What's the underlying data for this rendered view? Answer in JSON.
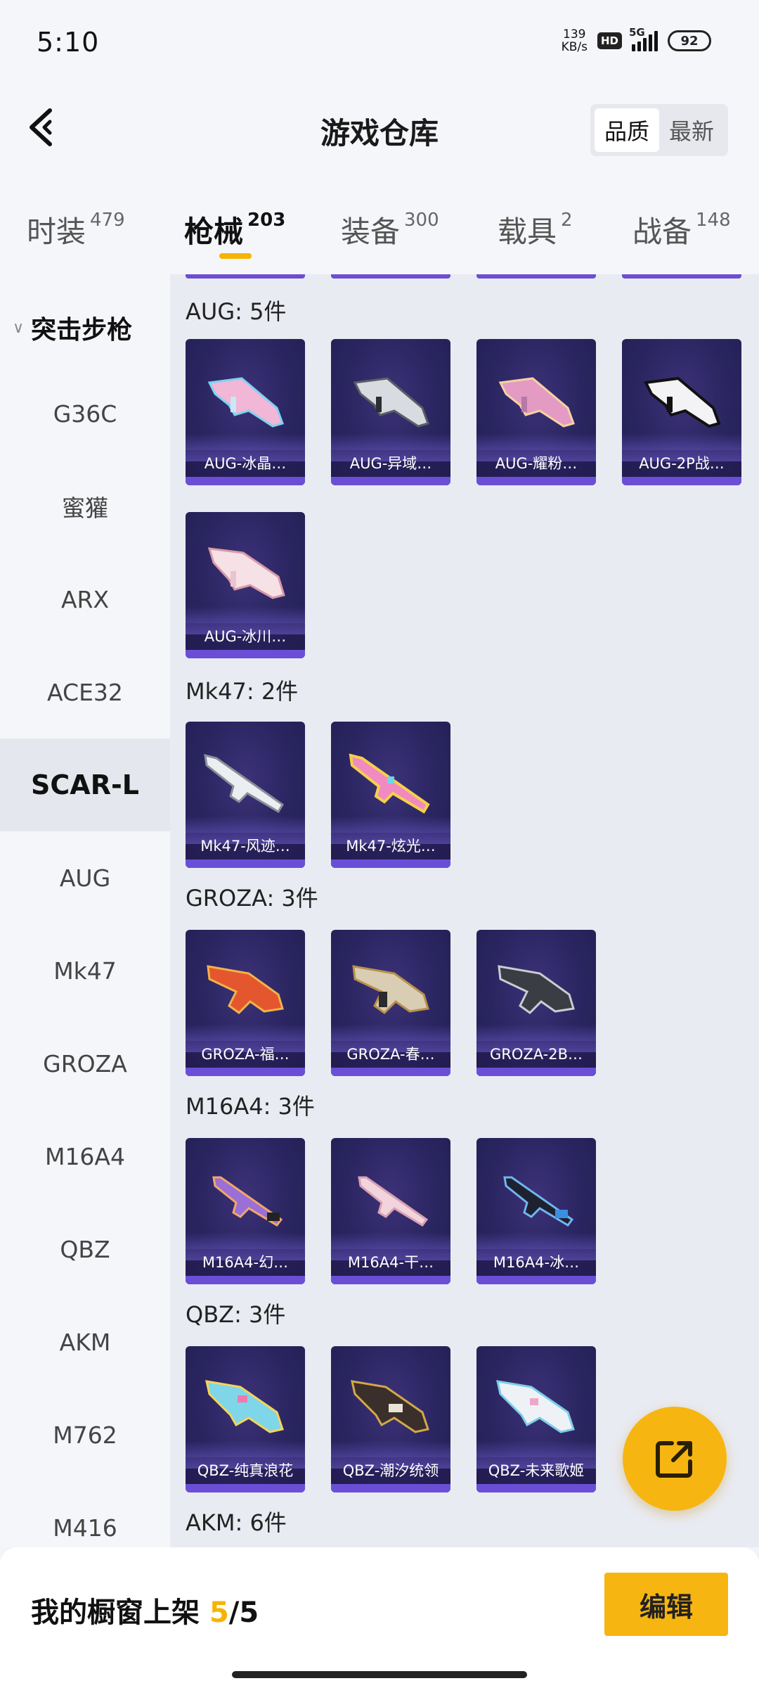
{
  "status_bar": {
    "time": "5:10",
    "net_speed_value": "139",
    "net_speed_unit": "KB/s",
    "hd_label": "HD",
    "network_type": "5G",
    "battery_level": "92"
  },
  "header": {
    "title": "游戏仓库",
    "sort_options": [
      "品质",
      "最新"
    ],
    "sort_active": "品质"
  },
  "tabs": [
    {
      "label": "时装",
      "count": "479"
    },
    {
      "label": "枪械",
      "count": "203"
    },
    {
      "label": "装备",
      "count": "300"
    },
    {
      "label": "载具",
      "count": "2"
    },
    {
      "label": "战备",
      "count": "148"
    }
  ],
  "sidebar": {
    "group_label": "突击步枪",
    "items": [
      "G36C",
      "蜜獾",
      "ARX",
      "ACE32",
      "SCAR-L",
      "AUG",
      "Mk47",
      "GROZA",
      "M16A4",
      "QBZ",
      "AKM",
      "M762",
      "M416"
    ],
    "active_item": "SCAR-L"
  },
  "sections": [
    {
      "title": "AUG: 5件",
      "items": [
        "AUG-冰晶…",
        "AUG-异域…",
        "AUG-耀粉…",
        "AUG-2P战…",
        "AUG-冰川…"
      ]
    },
    {
      "title": "Mk47: 2件",
      "items": [
        "Mk47-风迹…",
        "Mk47-炫光…"
      ]
    },
    {
      "title": "GROZA: 3件",
      "items": [
        "GROZA-福…",
        "GROZA-春…",
        "GROZA-2B…"
      ]
    },
    {
      "title": "M16A4: 3件",
      "items": [
        "M16A4-幻…",
        "M16A4-干…",
        "M16A4-冰…"
      ]
    },
    {
      "title": "QBZ: 3件",
      "items": [
        "QBZ-纯真浪花",
        "QBZ-潮汐统领",
        "QBZ-未来歌姬"
      ]
    },
    {
      "title": "AKM: 6件",
      "items": []
    }
  ],
  "bottom_bar": {
    "shelf_label": "我的橱窗上架",
    "shelf_current": "5",
    "shelf_separator": "/",
    "shelf_total": "5",
    "edit_label": "编辑"
  },
  "colors": {
    "accent": "#f7b512",
    "card_bg": "#2a2560",
    "card_strip": "#6a4fd6"
  },
  "icons": {
    "back": "chevron-left-icon",
    "fab": "share-external-icon"
  }
}
